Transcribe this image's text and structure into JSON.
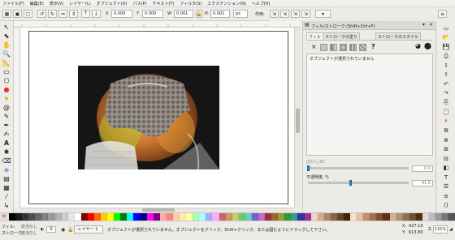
{
  "menubar": {
    "items": [
      "ファイル(F)",
      "編集(E)",
      "表示(V)",
      "レイヤー(L)",
      "オブジェクト(O)",
      "パス(P)",
      "テキスト(T)",
      "フィルタ(S)",
      "エクステンション(N)",
      "ヘルプ(H)"
    ]
  },
  "tool_controls": {
    "x_label": "X",
    "x_value": "0.000",
    "y_label": "Y",
    "y_value": "0.000",
    "w_label": "W",
    "w_value": "0.001",
    "h_label": "H",
    "h_value": "0.001",
    "unit": "px",
    "affect_label": "作用:"
  },
  "panel": {
    "title": "フィル/ストローク (Shift+Ctrl+F)",
    "tabs": [
      "フィル",
      "ストロークの塗り",
      "ストロークのスタイル"
    ],
    "fill_type_x": "×",
    "fill_type_question": "?",
    "no_selection": "オブジェクトが選択されていません",
    "blur_label": "ぼかし(B)",
    "blur_value": "0.0",
    "blur_fraction": 0.0,
    "opacity_label": "不透明度, %",
    "opacity_value": "41.6",
    "opacity_fraction": 0.416
  },
  "statusbar": {
    "fill_label": "フィル:",
    "fill_value": "該当なし",
    "stroke_label": "ストローク:",
    "stroke_value": "該当なし",
    "opacity_value": "0",
    "layer_name": "-レイヤー 1",
    "message": "オブジェクトが選択されていません。オブジェクトをクリック、Shift+クリック、または囲むようにドラッグして下さい。",
    "coord_x_label": "X:",
    "coord_x": "427.19",
    "coord_y_label": "Y:",
    "coord_y": "613.80",
    "zoom_label": "Z:",
    "zoom": "131%"
  },
  "colors": {
    "accent": "#3a8fd6",
    "palette": [
      "#000000",
      "#1a1a1a",
      "#333333",
      "#4d4d4d",
      "#666666",
      "#808080",
      "#999999",
      "#b3b3b3",
      "#cccccc",
      "#e6e6e6",
      "#ffffff",
      "#800000",
      "#ff0000",
      "#ff6600",
      "#ffcc00",
      "#ffff00",
      "#00ff00",
      "#008000",
      "#00ffff",
      "#0000ff",
      "#000080",
      "#ff00ff",
      "#800080",
      "#ffaaaa",
      "#ff8080",
      "#ffccaa",
      "#ffeeaa",
      "#ffffaa",
      "#aaffaa",
      "#aaffff",
      "#aaaaff",
      "#ffaaff",
      "#cc6666",
      "#cc9966",
      "#cccc66",
      "#66cc66",
      "#66cccc",
      "#6666cc",
      "#cc66cc",
      "#993333",
      "#996633",
      "#999933",
      "#339933",
      "#339999",
      "#333399",
      "#993399",
      "#e9d7c0",
      "#d4aa88",
      "#aa8866",
      "#886644",
      "#664422",
      "#442200",
      "#f4e0d0",
      "#e0c0a0",
      "#c09070",
      "#a07050",
      "#805030",
      "#603010",
      "#d0b090",
      "#b09070",
      "#907050",
      "#705030",
      "#503010",
      "#dddddd",
      "#bbbbbb",
      "#999999",
      "#777777",
      "#555555"
    ]
  },
  "icons": {
    "toolbox": [
      "select-arrow-icon",
      "node-tool-icon",
      "tweak-tool-icon",
      "zoom-tool-icon",
      "measure-tool-icon",
      "rectangle-tool-icon",
      "box3d-tool-icon",
      "ellipse-tool-icon",
      "star-tool-icon",
      "spiral-tool-icon",
      "pencil-tool-icon",
      "pen-tool-icon",
      "calligraphy-tool-icon",
      "text-tool-icon",
      "spray-tool-icon",
      "eraser-tool-icon",
      "bucket-tool-icon",
      "gradient-tool-icon",
      "mesh-tool-icon",
      "dropper-tool-icon",
      "connector-tool-icon"
    ],
    "rightbar": [
      "new-doc-icon",
      "open-icon",
      "save-icon",
      "print-icon",
      "import-icon",
      "export-icon",
      "undo-icon",
      "redo-icon",
      "copy-icon",
      "paste-icon",
      "zoom-icon",
      "duplicate-icon",
      "clone-icon",
      "group-icon",
      "ungroup-icon",
      "fill-stroke-icon",
      "text-font-icon",
      "layers-icon",
      "align-icon",
      "xml-icon"
    ]
  }
}
